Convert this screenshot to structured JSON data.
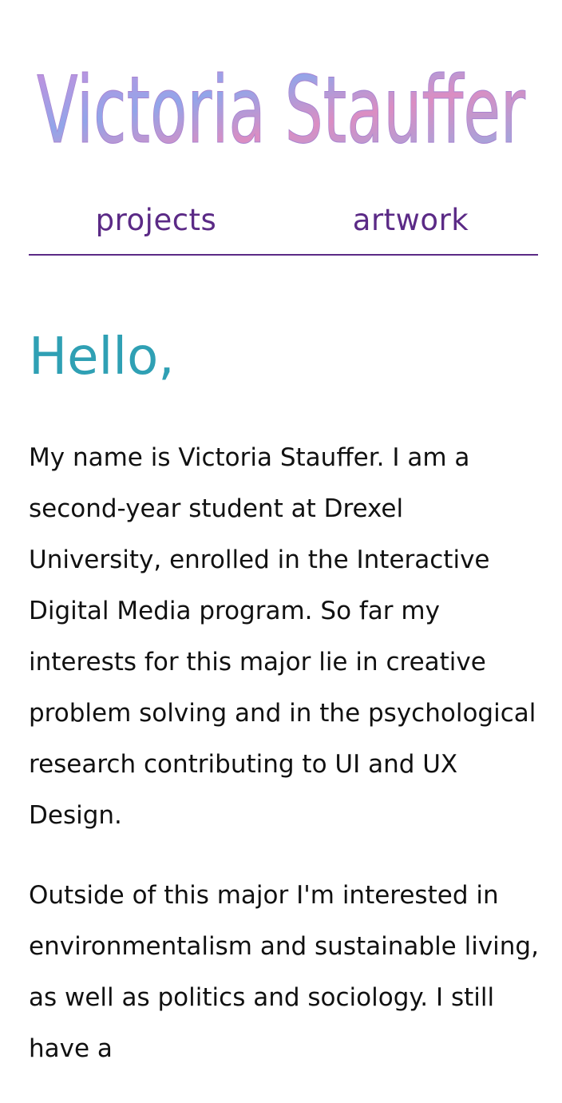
{
  "header": {
    "logo_text": "Victoria Stauffer",
    "logo_icon": "watercolor-signature-logo"
  },
  "nav": {
    "items": [
      {
        "label": "projects"
      },
      {
        "label": "artwork"
      }
    ]
  },
  "main": {
    "greeting": "Hello,",
    "paragraphs": [
      "My name is Victoria Stauffer. I am a second-year student at Drexel University, enrolled in the Interactive Digital Media program. So far my interests for this major lie in creative problem solving and in the psychological research contributing to UI and UX Design.",
      "Outside of this major I'm interested in environmentalism and sustainable living, as well as politics and sociology. I still have a"
    ]
  },
  "colors": {
    "nav_text": "#5b2a86",
    "nav_rule": "#5b2a86",
    "greeting": "#2fa0b4",
    "body_text": "#111111",
    "logo_a": "#b86fd0",
    "logo_b": "#6f8fe0"
  }
}
